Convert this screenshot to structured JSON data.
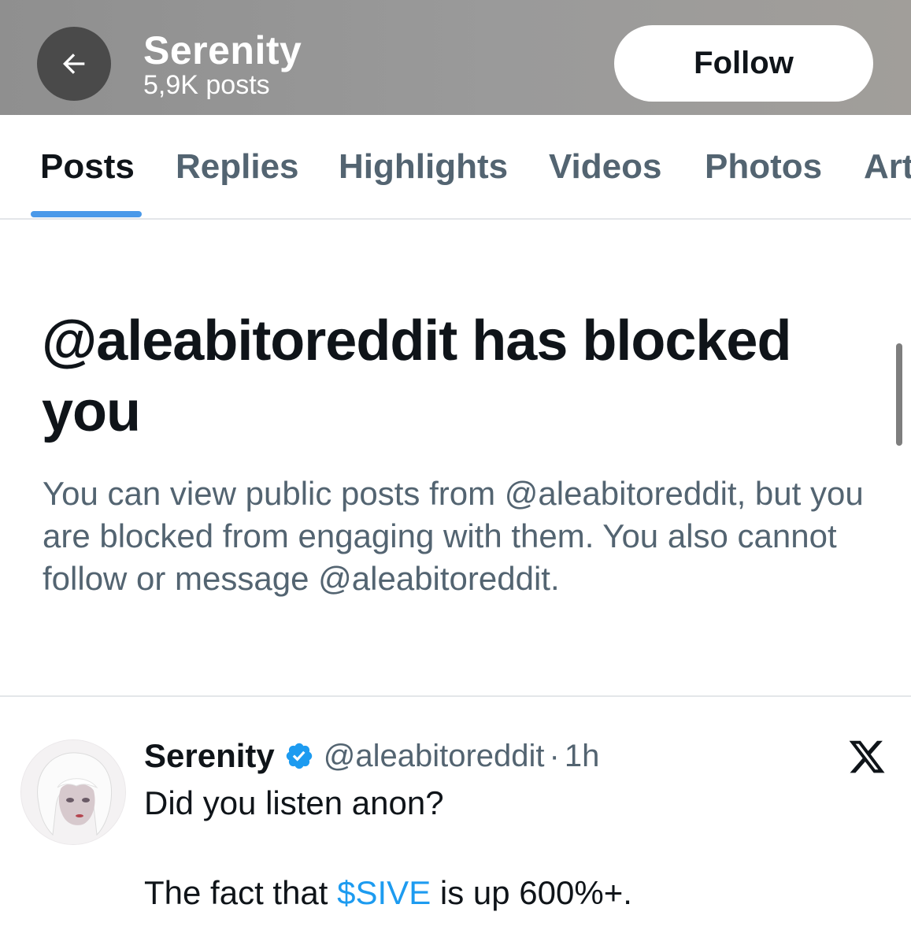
{
  "header": {
    "name": "Serenity",
    "post_count": "5,9K posts",
    "follow_label": "Follow"
  },
  "tabs": [
    {
      "label": "Posts",
      "active": true
    },
    {
      "label": "Replies",
      "active": false
    },
    {
      "label": "Highlights",
      "active": false
    },
    {
      "label": "Videos",
      "active": false
    },
    {
      "label": "Photos",
      "active": false
    },
    {
      "label": "Art",
      "active": false
    }
  ],
  "blocked": {
    "title": "@aleabitoreddit has blocked you",
    "description": "You can view public posts from @aleabitoreddit, but you are blocked from engaging with them. You also cannot follow or message @aleabitoreddit."
  },
  "post": {
    "author_name": "Serenity",
    "handle": "@aleabitoreddit",
    "separator": "·",
    "time": "1h",
    "text_line1": "Did you listen anon?",
    "text_line2_prefix": "The fact that ",
    "cashtag": "$SIVE",
    "text_line2_suffix": " is up 600%+."
  },
  "icons": {
    "back": "arrow-left-icon",
    "verified": "verified-badge-icon",
    "platform": "x-logo-icon"
  },
  "colors": {
    "accent": "#1d9bf0",
    "tab_indicator": "#4a99e9",
    "secondary_text": "#536471",
    "primary_text": "#0f1419"
  }
}
